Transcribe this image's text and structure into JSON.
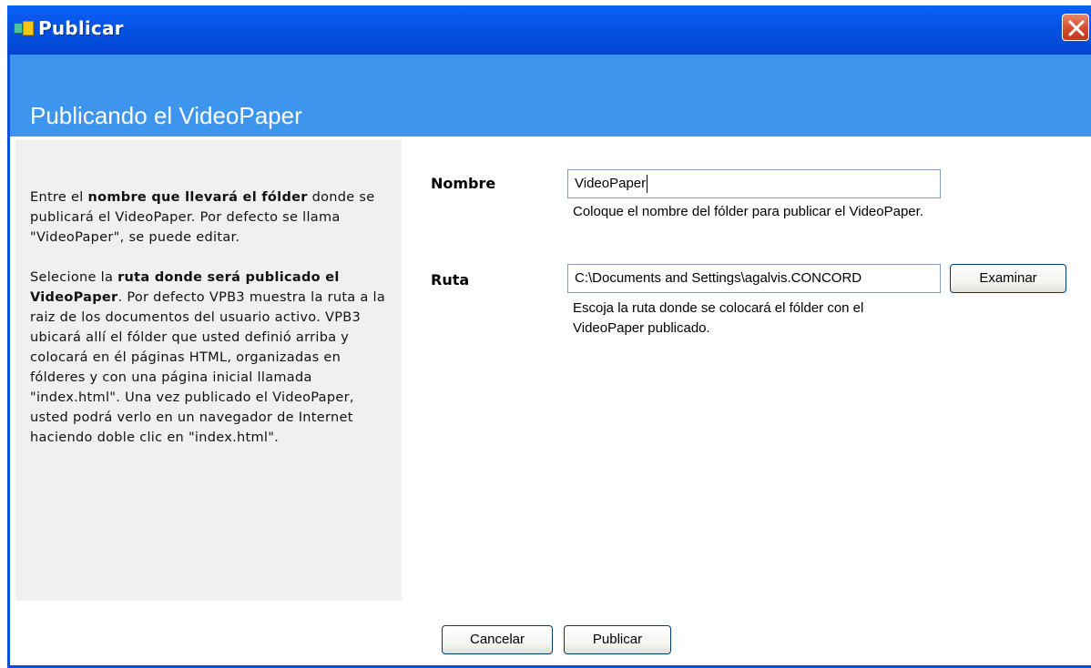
{
  "window": {
    "title": "Publicar",
    "header_title": "Publicando el VideoPaper"
  },
  "help": {
    "p1_pre": "Entre el ",
    "p1_bold": "nombre que llevará el fólder",
    "p1_post": " donde se publicará el VideoPaper. Por defecto se llama \"VideoPaper\", se puede editar.",
    "p2_pre": "Selecione la ",
    "p2_bold": "ruta donde será publicado el VideoPaper",
    "p2_post": ". Por defecto VPB3 muestra la ruta a la raiz de los documentos del usuario activo. VPB3 ubicará allí el fólder que usted definió arriba y colocará en él páginas HTML, organizadas en fólderes y con una página inicial llamada \"index.html\". Una vez publicado el VideoPaper, usted podrá verlo en un navegador de Internet haciendo doble clic en \"index.html\"."
  },
  "form": {
    "nombre_label": "Nombre",
    "nombre_value": "VideoPaper",
    "nombre_hint": "Coloque el nombre del fólder para publicar el VideoPaper.",
    "ruta_label": "Ruta",
    "ruta_value": "C:\\Documents and Settings\\agalvis.CONCORD",
    "ruta_hint": "Escoja la ruta donde se colocará el fólder con el VideoPaper publicado.",
    "browse_label": "Examinar"
  },
  "buttons": {
    "cancel_label": "Cancelar",
    "publish_label": "Publicar"
  },
  "colors": {
    "titlebar": "#0553e4",
    "header_band": "#3d95ee",
    "close_button": "#d3472a",
    "help_panel": "#f0f0f0"
  }
}
